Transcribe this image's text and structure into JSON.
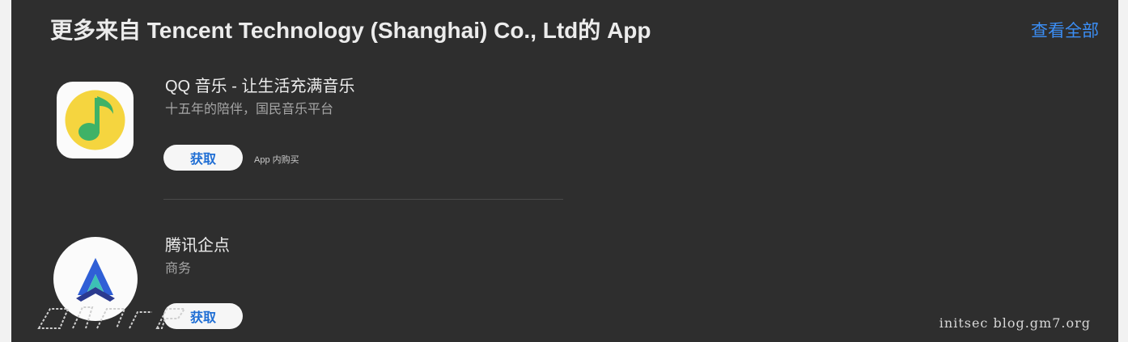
{
  "section": {
    "title": "更多来自 Tencent Technology (Shanghai) Co., Ltd的 App",
    "see_all": "查看全部"
  },
  "apps": [
    {
      "name": "QQ 音乐 - 让生活充满音乐",
      "subtitle": "十五年的陪伴，国民音乐平台",
      "button": "获取",
      "note": "App 内购买",
      "icon": "qq-music-icon"
    },
    {
      "name": "腾讯企点",
      "subtitle": "商务",
      "button": "获取",
      "icon": "tencent-qidian-icon"
    }
  ],
  "watermark": {
    "text": "initsec blog.gm7.org"
  },
  "colors": {
    "background": "#2e2e2e",
    "accent": "#3b8ef5",
    "qq_music_yellow": "#f5d53f",
    "qq_music_green": "#3fb267",
    "qidian_blue": "#2f5fd6"
  }
}
